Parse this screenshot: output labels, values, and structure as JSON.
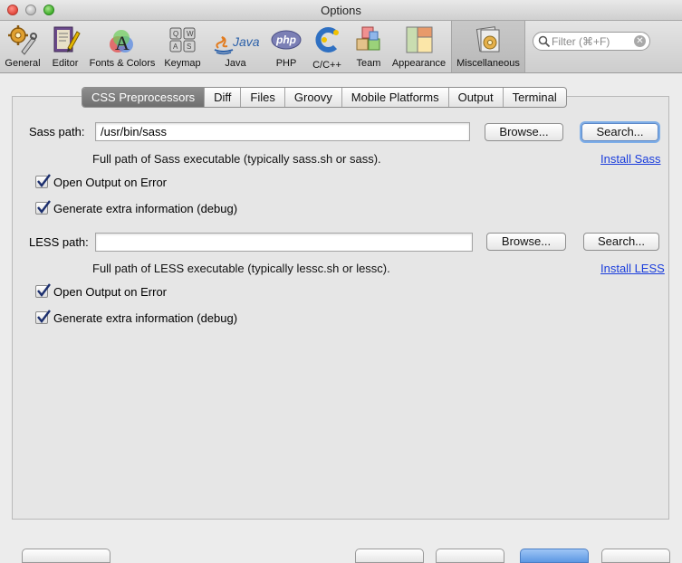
{
  "window": {
    "title": "Options"
  },
  "toolbar": {
    "items": [
      {
        "label": "General",
        "icon": "gear-wrench-icon"
      },
      {
        "label": "Editor",
        "icon": "editor-icon"
      },
      {
        "label": "Fonts & Colors",
        "icon": "fonts-colors-icon"
      },
      {
        "label": "Keymap",
        "icon": "keymap-icon"
      },
      {
        "label": "Java",
        "icon": "java-icon",
        "logo_text": "Java"
      },
      {
        "label": "PHP",
        "icon": "php-icon",
        "logo_text": "php"
      },
      {
        "label": "C/C++",
        "icon": "cpp-icon"
      },
      {
        "label": "Team",
        "icon": "team-icon"
      },
      {
        "label": "Appearance",
        "icon": "appearance-icon"
      },
      {
        "label": "Miscellaneous",
        "icon": "miscellaneous-icon"
      }
    ],
    "selected": "Miscellaneous"
  },
  "filter": {
    "placeholder": "Filter (⌘+F)",
    "value": ""
  },
  "tabs": [
    {
      "label": "CSS Preprocessors"
    },
    {
      "label": "Diff"
    },
    {
      "label": "Files"
    },
    {
      "label": "Groovy"
    },
    {
      "label": "Mobile Platforms"
    },
    {
      "label": "Output"
    },
    {
      "label": "Terminal"
    }
  ],
  "active_tab": "CSS Preprocessors",
  "sass": {
    "path_label": "Sass path:",
    "path_value": "/usr/bin/sass",
    "browse_label": "Browse...",
    "search_label": "Search...",
    "help": "Full path of Sass executable (typically sass.sh or sass).",
    "install_link": "Install Sass",
    "open_output_label": "Open Output on Error",
    "open_output_checked": true,
    "debug_label": "Generate extra information (debug)",
    "debug_checked": true
  },
  "less": {
    "path_label": "LESS path:",
    "path_value": "",
    "browse_label": "Browse...",
    "search_label": "Search...",
    "help": "Full path of LESS executable (typically lessc.sh or lessc).",
    "install_link": "Install LESS",
    "open_output_label": "Open Output on Error",
    "open_output_checked": true,
    "debug_label": "Generate extra information (debug)",
    "debug_checked": true
  },
  "colors": {
    "accent": "#7eaee8",
    "link": "#1a3ddc",
    "active_tab": "#7a7a7a"
  }
}
